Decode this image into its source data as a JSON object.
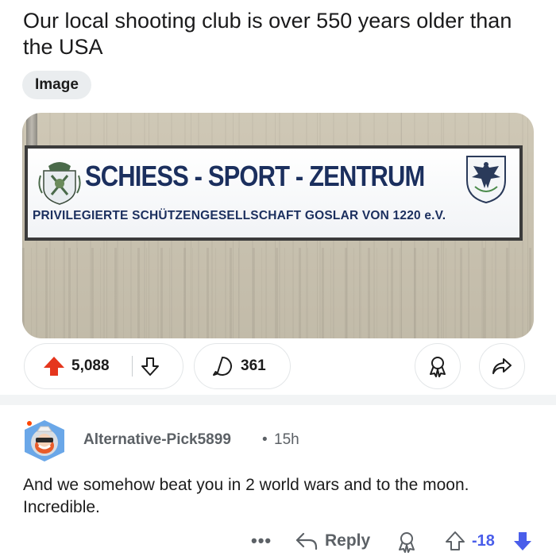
{
  "post": {
    "title": "Our local shooting club is over 550 years older than the USA",
    "tag": "Image"
  },
  "image": {
    "sign_main": "SCHIESS - SPORT - ZENTRUM",
    "sign_sub": "PRIVILEGIERTE SCHÜTZENGESELLSCHAFT GOSLAR VON 1220 e.V."
  },
  "actions": {
    "upvotes": "5,088",
    "comments": "361"
  },
  "comment": {
    "username": "Alternative-Pick5899",
    "separator": "•",
    "time": "15h",
    "body": "And we somehow beat you in 2 world wars and to the moon. Incredible.",
    "more": "•••",
    "reply_label": "Reply",
    "score": "-18"
  },
  "colors": {
    "upvote": "#e5361d",
    "downvote_active": "#4a5eea",
    "meta_text": "#5c6166",
    "pill_border": "#e3e6e8",
    "tag_bg": "#eaedef",
    "sign_text": "#1b2f5e"
  },
  "icons": [
    "upvote-icon",
    "downvote-icon",
    "comment-icon",
    "award-icon",
    "share-icon",
    "reply-icon",
    "more-icon"
  ]
}
